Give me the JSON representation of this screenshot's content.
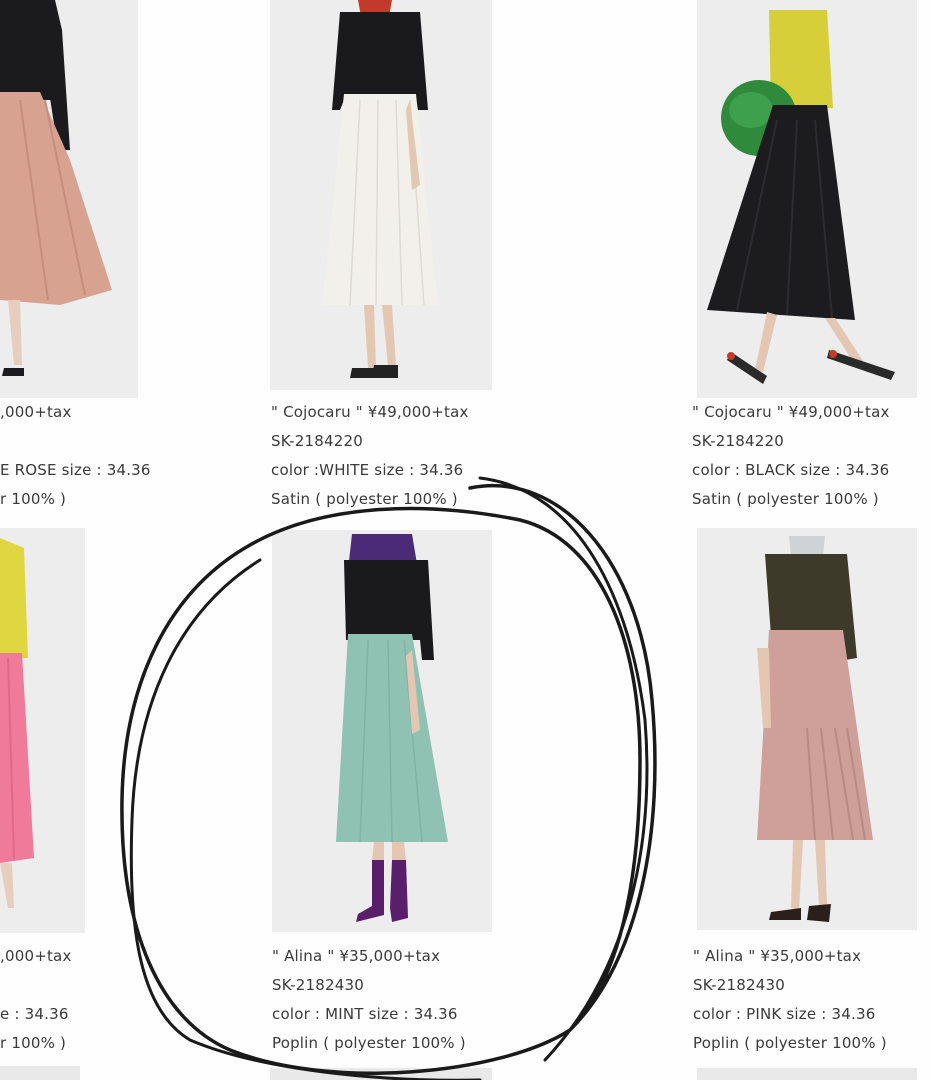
{
  "products": [
    {
      "id": "top-left",
      "lines": [
        ",000+tax",
        "E ROSE   size : 34.36",
        "r 100% )"
      ],
      "colors": {
        "skirt": "#d7a28f",
        "top": "#1b1b1d"
      }
    },
    {
      "id": "top-middle",
      "lines": [
        "\" Cojocaru \" ¥49,000+tax",
        "SK-2184220",
        "color :WHITE   size : 34.36",
        "Satin ( polyester 100% )"
      ],
      "colors": {
        "skirt": "#f2f0ea",
        "top": "#1a1a1c",
        "scarf": "#c23a2a"
      }
    },
    {
      "id": "top-right",
      "lines": [
        "\" Cojocaru \" ¥49,000+tax",
        "SK-2184220",
        "color : BLACK   size : 34.36",
        "Satin ( polyester 100% )"
      ],
      "colors": {
        "skirt": "#1c1c1f",
        "top": "#d6cf3a",
        "bag": "#2f8a3c"
      }
    },
    {
      "id": "bottom-left",
      "lines": [
        ",000+tax",
        "e : 34.36",
        "r 100% )"
      ],
      "colors": {
        "skirt": "#f07a9a",
        "top": "#e0d640"
      }
    },
    {
      "id": "bottom-middle",
      "lines": [
        "\" Alina \" ¥35,000+tax",
        "SK-2182430",
        "color : MINT   size : 34.36",
        "Poplin ( polyester 100% )"
      ],
      "colors": {
        "skirt": "#8fc2b2",
        "top": "#1a1a1c",
        "scarf": "#4b2a78",
        "boots": "#5a1f6b"
      }
    },
    {
      "id": "bottom-right",
      "lines": [
        "\" Alina \" ¥35,000+tax",
        "SK-2182430",
        "color : PINK   size : 34.36",
        "Poplin ( polyester 100% )"
      ],
      "colors": {
        "skirt": "#cfa09a",
        "top": "#3e3a2a"
      }
    }
  ],
  "annotation": {
    "stroke": "#1a1a1a",
    "circled_item": "bottom-middle"
  }
}
